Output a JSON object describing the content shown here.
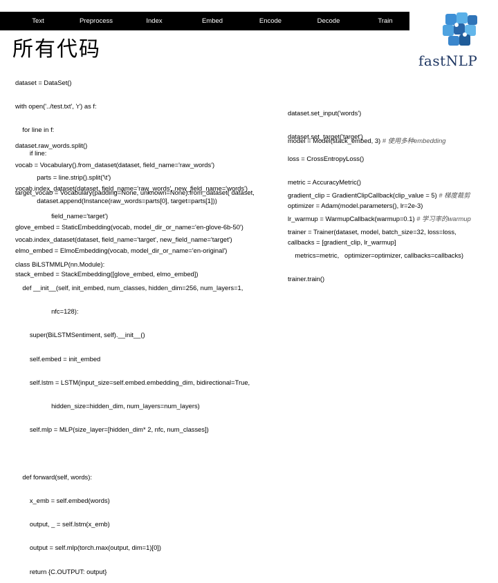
{
  "nav": {
    "items": [
      "Text",
      "Preprocess",
      "Index",
      "Embed",
      "Encode",
      "Decode",
      "Train"
    ]
  },
  "title": "所有代码",
  "logo": {
    "text": "fastNLP",
    "icon": "puzzle-pieces-icon"
  },
  "left_blocks": [
    {
      "name": "dataset-block",
      "lines": [
        "dataset = DataSet()",
        "with open('../test.txt', 'r') as f:",
        "    for line in f:",
        "        if line:",
        "            parts = line.strip().split('\\t')",
        "            dataset.append(Instance(raw_words=parts[0], target=parts[1]))"
      ]
    },
    {
      "name": "split-block",
      "lines": [
        "dataset.raw_words.split()"
      ]
    },
    {
      "name": "vocab-block",
      "lines": [
        "vocab = Vocabulary().from_dataset(dataset, field_name='raw_words')",
        "vocab.index_dataset(dataset, field_name='raw_words', new_field_name='words')"
      ]
    },
    {
      "name": "target-vocab-block",
      "lines": [
        "target_vocab = Vocabulary(padding=None, unknown=None).from_dataset( dataset,",
        "                    field_name='target')",
        "vocab.index_dataset(dataset, field_name='target', new_field_name='target')"
      ]
    },
    {
      "name": "embed-block",
      "lines": [
        "glove_embed = StaticEmbedding(vocab, model_dir_or_name='en-glove-6b-50')",
        "elmo_embed = ElmoEmbedding(vocab, model_dir_or_name='en-original')",
        "stack_embed = StackEmbedding([glove_embed, elmo_embed])"
      ]
    },
    {
      "name": "model-class-block",
      "lines": [
        "class BiLSTMMLP(nn.Module):",
        "    def __init__(self, init_embed, num_classes, hidden_dim=256, num_layers=1,",
        "                    nfc=128):",
        "        super(BiLSTMSentiment, self).__init__()",
        "        self.embed = init_embed",
        "        self.lstm = LSTM(input_size=self.embed.embedding_dim, bidirectional=True,",
        "                    hidden_size=hidden_dim, num_layers=num_layers)",
        "        self.mlp = MLP(size_layer=[hidden_dim* 2, nfc, num_classes])",
        "",
        "    def forward(self, words):",
        "        x_emb = self.embed(words)",
        "        output, _ = self.lstm(x_emb)",
        "        output = self.mlp(torch.max(output, dim=1)[0])",
        "        return {C.OUTPUT: output}"
      ]
    }
  ],
  "right_blocks": [
    {
      "name": "set-input-block",
      "lines": [
        "dataset.set_input('words')",
        "dataset.set_target('target')"
      ]
    },
    {
      "name": "model-block",
      "lines": [
        "model = Model(stack_embed, 3)"
      ],
      "comment": "# 使用多种embedding"
    },
    {
      "name": "loss-block",
      "lines": [
        "loss = CrossEntropyLoss()",
        "metric = AccuracyMetric()",
        "optimizer = Adam(model.parameters(), lr=2e-3)"
      ]
    },
    {
      "name": "callback-block",
      "lines": [
        "gradient_clip = GradientClipCallback(clip_value = 5)",
        "lr_warmup = WarmupCallback(warmup=0.1)",
        "callbacks = [gradient_clip, lr_warmup]"
      ],
      "comments": [
        "# 梯度裁剪",
        "# 学习率的warmup",
        ""
      ]
    },
    {
      "name": "trainer-block",
      "lines": [
        "trainer = Trainer(dataset, model, batch_size=32, loss=loss,",
        "    metrics=metric,   optimizer=optimizer, callbacks=callbacks)",
        "trainer.train()"
      ]
    }
  ]
}
